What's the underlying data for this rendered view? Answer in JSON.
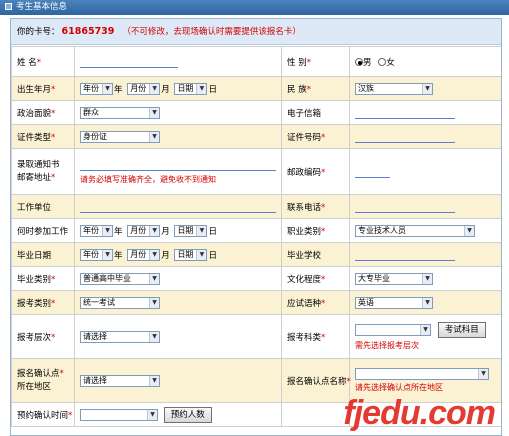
{
  "window": {
    "title": "考生基本信息"
  },
  "card": {
    "prefix": "你的卡号：",
    "number": "61865739",
    "note": "（不可修改，去现场确认时需要提供该报名卡）"
  },
  "fields": {
    "name": {
      "label": "姓 名",
      "value": ""
    },
    "gender": {
      "label": "性 别",
      "options": [
        "男",
        "女"
      ],
      "selected": "男"
    },
    "birth": {
      "label": "出生年月",
      "year": "年份",
      "month": "月份",
      "day": "日期",
      "y_unit": "年",
      "m_unit": "月",
      "d_unit": "日"
    },
    "ethnicity": {
      "label": "民 族",
      "value": "汉族"
    },
    "politics": {
      "label": "政治面貌",
      "value": "群众"
    },
    "email": {
      "label": "电子信箱",
      "value": ""
    },
    "id_type": {
      "label": "证件类型",
      "value": "身份证"
    },
    "id_number": {
      "label": "证件号码",
      "value": ""
    },
    "address": {
      "label_line1": "录取通知书",
      "label_line2": "邮寄地址",
      "value": "",
      "hint": "请务必填写准确齐全，避免收不到通知"
    },
    "postcode": {
      "label": "邮政编码",
      "value": ""
    },
    "work_unit": {
      "label": "工作单位",
      "value": ""
    },
    "phone": {
      "label": "联系电话",
      "value": ""
    },
    "work_start": {
      "label": "何时参加工作",
      "year": "年份",
      "month": "月份",
      "day": "日期",
      "y_unit": "年",
      "m_unit": "月",
      "d_unit": "日"
    },
    "occupation": {
      "label": "职业类别",
      "value": "专业技术人员"
    },
    "grad_date": {
      "label": "毕业日期",
      "year": "年份",
      "month": "月份",
      "day": "日期",
      "y_unit": "年",
      "m_unit": "月",
      "d_unit": "日"
    },
    "grad_school": {
      "label": "毕业学校",
      "value": ""
    },
    "grad_type": {
      "label": "毕业类别",
      "value": "普通高中毕业"
    },
    "education": {
      "label": "文化程度",
      "value": "大专毕业"
    },
    "exam_type": {
      "label": "报考类别",
      "value": "统一考试"
    },
    "exam_language": {
      "label": "应试语种",
      "value": "英语"
    },
    "exam_level": {
      "label": "报考层次",
      "value": "请选择"
    },
    "exam_subject": {
      "label": "报考科类",
      "value": "",
      "button": "考试科目",
      "hint": "需先选择报考层次"
    },
    "confirm_area": {
      "label_line1": "报名确认点",
      "label_line2": "所在地区",
      "value": "请选择"
    },
    "confirm_point": {
      "label": "报名确认点名称",
      "value": "",
      "hint": "请先选择确认点所在地区"
    },
    "appointment": {
      "label": "预约确认时间",
      "value": "",
      "button": "预约人数"
    }
  },
  "watermark": {
    "text_a": "fjedu",
    "text_b": "com"
  }
}
